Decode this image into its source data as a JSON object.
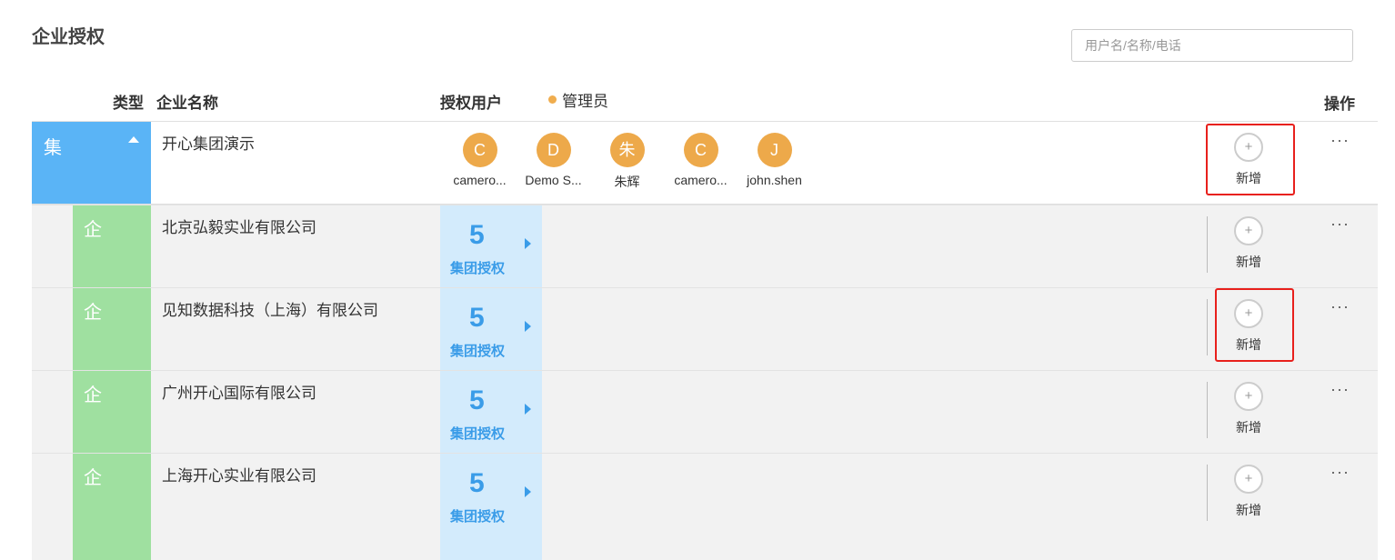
{
  "page": {
    "title": "企业授权"
  },
  "search": {
    "placeholder": "用户名/名称/电话"
  },
  "table": {
    "headers": {
      "type": "类型",
      "name": "企业名称",
      "users": "授权用户",
      "admin_legend": "管理员",
      "ops": "操作"
    }
  },
  "group_row": {
    "type": "集",
    "name": "开心集团演示",
    "users": [
      {
        "initial": "C",
        "name": "camero..."
      },
      {
        "initial": "D",
        "name": "Demo S..."
      },
      {
        "initial": "朱",
        "name": "朱辉"
      },
      {
        "initial": "C",
        "name": "camero..."
      },
      {
        "initial": "J",
        "name": "john.shen"
      }
    ],
    "add_label": "新增",
    "add_icon": "+",
    "more": "···"
  },
  "enterprise_rows": [
    {
      "type": "企",
      "name": "北京弘毅实业有限公司",
      "count": "5",
      "auth_label": "集团授权",
      "add_label": "新增",
      "add_icon": "+",
      "more": "···"
    },
    {
      "type": "企",
      "name": "见知数据科技（上海）有限公司",
      "count": "5",
      "auth_label": "集团授权",
      "add_label": "新增",
      "add_icon": "+",
      "more": "···"
    },
    {
      "type": "企",
      "name": "广州开心国际有限公司",
      "count": "5",
      "auth_label": "集团授权",
      "add_label": "新增",
      "add_icon": "+",
      "more": "···"
    },
    {
      "type": "企",
      "name": "上海开心实业有限公司",
      "count": "5",
      "auth_label": "集团授权",
      "add_label": "新增",
      "add_icon": "+",
      "more": "···"
    }
  ],
  "colors": {
    "group_type": "#5AB4F6",
    "enterprise_type": "#9FE0A0",
    "avatar": "#EDA94A",
    "auth_bg": "#D3EBFC",
    "auth_text": "#3A9CE8",
    "highlight": "#E8201C"
  }
}
